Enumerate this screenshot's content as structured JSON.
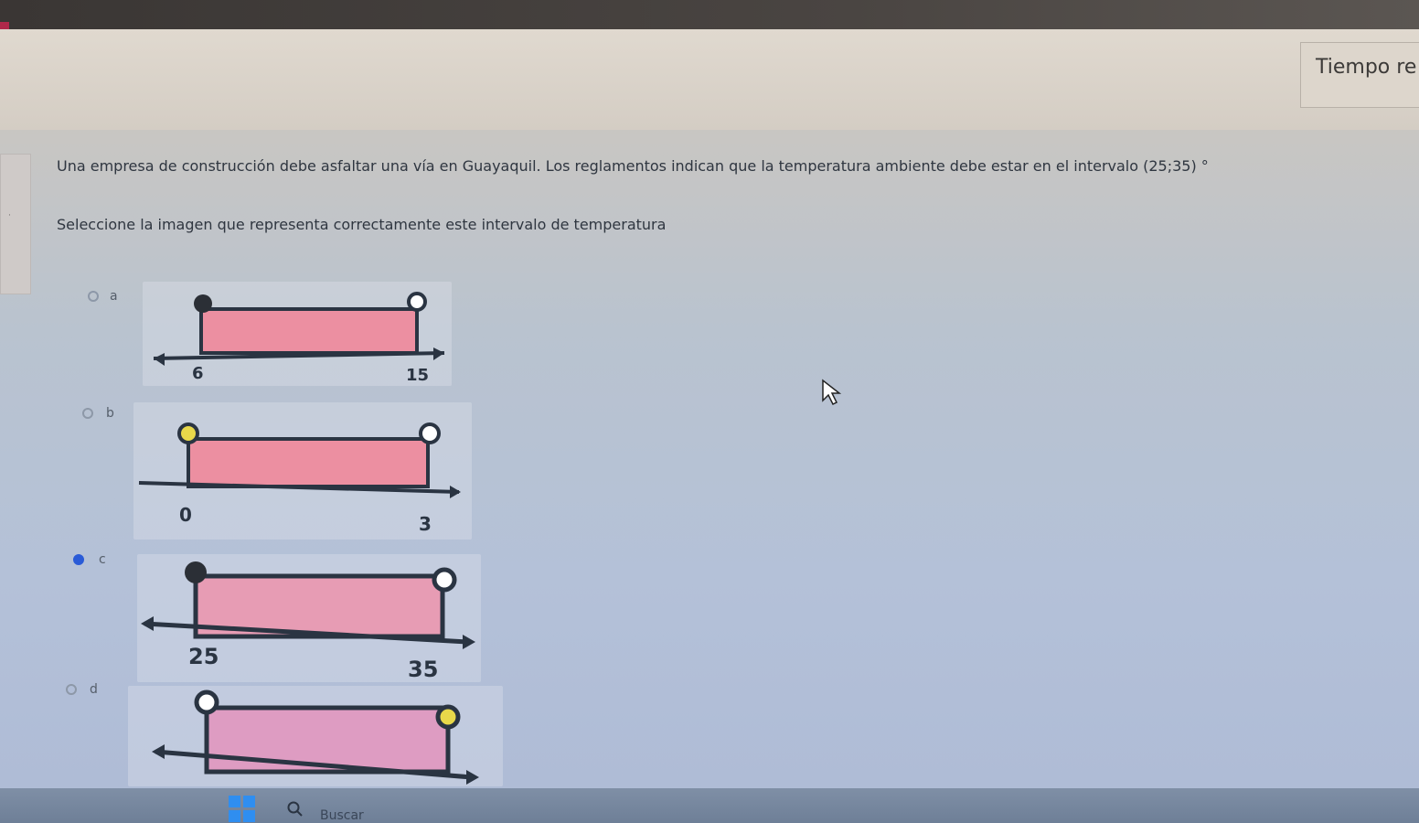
{
  "timer": {
    "label": "Tiempo re"
  },
  "question": {
    "text": "Una empresa de construcción debe asfaltar una vía en Guayaquil. Los reglamentos indican que la temperatura ambiente debe estar en el intervalo (25;35) °",
    "instruction": "Seleccione la imagen que representa correctamente este intervalo de temperatura"
  },
  "options": [
    {
      "letter": "a",
      "left_value": "6",
      "right_value": "15",
      "selected": false
    },
    {
      "letter": "b",
      "left_value": "0",
      "right_value": "3",
      "selected": false
    },
    {
      "letter": "c",
      "left_value": "25",
      "right_value": "35",
      "selected": true
    },
    {
      "letter": "d",
      "left_value": "",
      "right_value": "",
      "selected": false
    }
  ],
  "colors": {
    "interval_fill": "#ec8fa1",
    "axis": "#2a3442",
    "closed_dot": "#2b2f36",
    "yellow_dot": "#e8d84a",
    "radio_selected": "#2a5bd7"
  },
  "taskbar": {
    "search_label": "Buscar"
  }
}
